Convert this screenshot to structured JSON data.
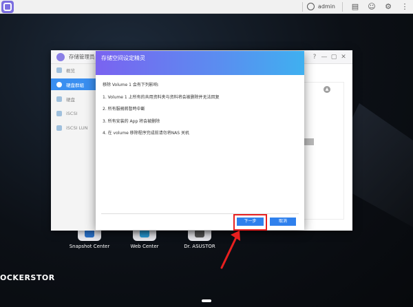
{
  "taskbar": {
    "user": "admin"
  },
  "window": {
    "title": "存储管理员",
    "controls": [
      "?",
      "—",
      "▢",
      "✕"
    ],
    "sidebar": [
      {
        "label": "概览",
        "active": false
      },
      {
        "label": "硬盘群組",
        "active": true
      },
      {
        "label": "硬盘",
        "active": false
      },
      {
        "label": "iSCSI",
        "active": false
      },
      {
        "label": "iSCSI LUN",
        "active": false
      }
    ]
  },
  "dialog": {
    "title": "存储空间设定精灵",
    "lines": [
      "移除 Volume 1 会有下列影响:",
      "1. Volume 1 上所有的共用资料夹与资料将会被删除并无法回复",
      "2. 所有服務將暫時中斷",
      "3. 所有安装的 App 将会被删除",
      "4. 在 volume 移除程序完成前请勿将NAS 关机"
    ],
    "next_label": "下一步",
    "cancel_label": "取消"
  },
  "desktop": {
    "icons": [
      {
        "label": "Snapshot Center"
      },
      {
        "label": "Web Center"
      },
      {
        "label": "Dr. ASUSTOR"
      }
    ],
    "brand": "OCKERSTOR"
  },
  "colors": {
    "accent": "#2f80ed",
    "highlight": "#e81f1f",
    "header_gradient_start": "#7a63f0",
    "header_gradient_end": "#3fb0f0"
  }
}
